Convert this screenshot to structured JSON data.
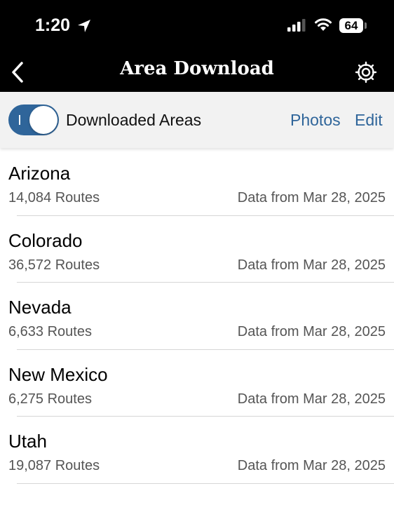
{
  "status_bar": {
    "time": "1:20",
    "battery": "64",
    "location_icon": "location-arrow-icon",
    "signal_icon": "cellular-signal-icon",
    "wifi_icon": "wifi-icon"
  },
  "nav": {
    "title": "Area Download",
    "back_icon": "chevron-left-icon",
    "settings_icon": "gear-icon"
  },
  "toolbar": {
    "toggle_label": "Downloaded Areas",
    "toggle_on": true,
    "photos_label": "Photos",
    "edit_label": "Edit"
  },
  "areas": [
    {
      "name": "Arizona",
      "routes": "14,084 Routes",
      "date": "Data from Mar 28, 2025"
    },
    {
      "name": "Colorado",
      "routes": "36,572 Routes",
      "date": "Data from Mar 28, 2025"
    },
    {
      "name": "Nevada",
      "routes": "6,633 Routes",
      "date": "Data from Mar 28, 2025"
    },
    {
      "name": "New Mexico",
      "routes": "6,275 Routes",
      "date": "Data from Mar 28, 2025"
    },
    {
      "name": "Utah",
      "routes": "19,087 Routes",
      "date": "Data from Mar 28, 2025"
    }
  ],
  "colors": {
    "accent": "#2f659a",
    "header_bg": "#000000",
    "toolbar_bg": "#f2f2f2"
  }
}
